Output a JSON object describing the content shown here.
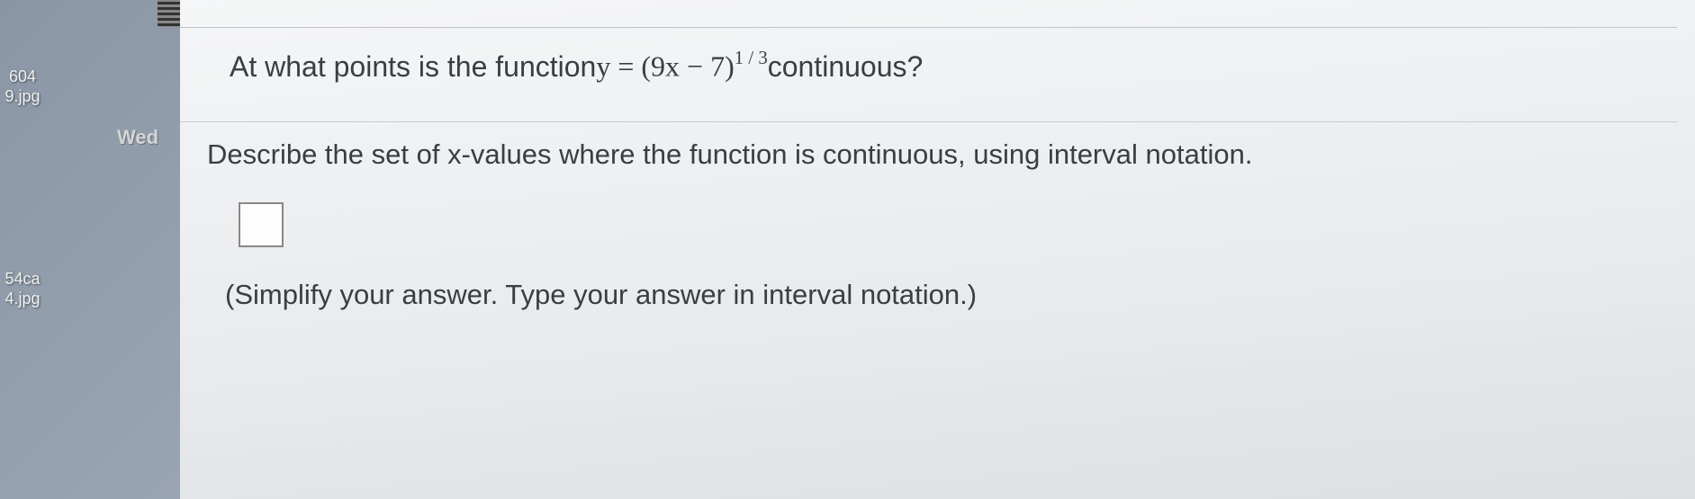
{
  "desktop": {
    "file1": {
      "name_line1": "604",
      "name_line2": "9.jpg"
    },
    "file2": {
      "name_line1": "54ca",
      "name_line2": "4.jpg"
    },
    "day_label": "Wed"
  },
  "question": {
    "prefix": "At what points is the function ",
    "expr_lhs": "y = (9x − 7)",
    "expr_exp": "1 / 3",
    "suffix": " continuous?"
  },
  "instruction": "Describe the set of x-values where the function is continuous, using interval notation.",
  "answer_value": "",
  "hint": "(Simplify your answer. Type your answer in interval notation.)"
}
